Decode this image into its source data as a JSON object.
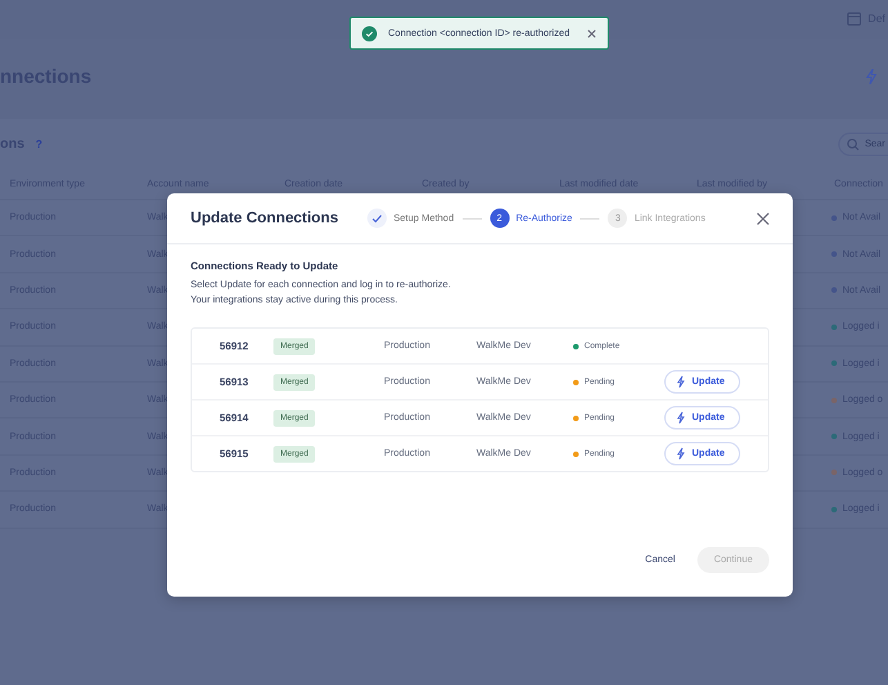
{
  "toast": {
    "message": "Connection <connection ID> re-authorized"
  },
  "page": {
    "top_button": "Def",
    "title": "nnections",
    "section_title": "ons",
    "help": "?",
    "search_placeholder": "Sear",
    "columns": [
      "Environment type",
      "Account name",
      "Creation date",
      "Created by",
      "Last modified date",
      "Last modified by",
      "Connection"
    ],
    "rows": [
      {
        "environment": "Production",
        "account": "Walk",
        "status": "Not Avail",
        "color": "#44548a"
      },
      {
        "environment": "Production",
        "account": "Walk",
        "status": "Not Avail",
        "color": "#44548a"
      },
      {
        "environment": "Production",
        "account": "Walk",
        "status": "Not Avail",
        "color": "#44548a"
      },
      {
        "environment": "Production",
        "account": "Walk",
        "status": "Logged i",
        "color": "#2c6a78"
      },
      {
        "environment": "Production",
        "account": "Walk",
        "status": "Logged i",
        "color": "#2c6a78"
      },
      {
        "environment": "Production",
        "account": "Walk",
        "status": "Logged o",
        "color": "#7a6468"
      },
      {
        "environment": "Production",
        "account": "Walk",
        "status": "Logged i",
        "color": "#2c6a78"
      },
      {
        "environment": "Production",
        "account": "Walk",
        "status": "Logged o",
        "color": "#7a6468"
      },
      {
        "environment": "Production",
        "account": "Walk",
        "status": "Logged i",
        "color": "#2c6a78"
      }
    ]
  },
  "modal": {
    "title": "Update Connections",
    "steps": [
      {
        "label": "Setup Method",
        "completed": true,
        "selected": false
      },
      {
        "number": "2",
        "label": "Re-Authorize",
        "completed": false,
        "selected": true
      },
      {
        "number": "3",
        "label": "Link Integrations",
        "completed": false,
        "selected": false
      }
    ],
    "heading": "Connections Ready to Update",
    "description": [
      "Select Update for each connection and log in to re-authorize.",
      "Your integrations stay active during this process."
    ],
    "rows": [
      {
        "id": "56912",
        "tag": "Merged",
        "environment": "Production",
        "account": "WalkMe Dev",
        "status": "Complete",
        "kind": "complete"
      },
      {
        "id": "56913",
        "tag": "Merged",
        "environment": "Production",
        "account": "WalkMe Dev",
        "status": "Pending",
        "kind": "pending",
        "action": "Update"
      },
      {
        "id": "56914",
        "tag": "Merged",
        "environment": "Production",
        "account": "WalkMe Dev",
        "status": "Pending",
        "kind": "pending",
        "action": "Update"
      },
      {
        "id": "56915",
        "tag": "Merged",
        "environment": "Production",
        "account": "WalkMe Dev",
        "status": "Pending",
        "kind": "pending",
        "action": "Update"
      }
    ],
    "cancel": "Cancel",
    "continue": {
      "label": "Continue",
      "disabled": true
    }
  }
}
